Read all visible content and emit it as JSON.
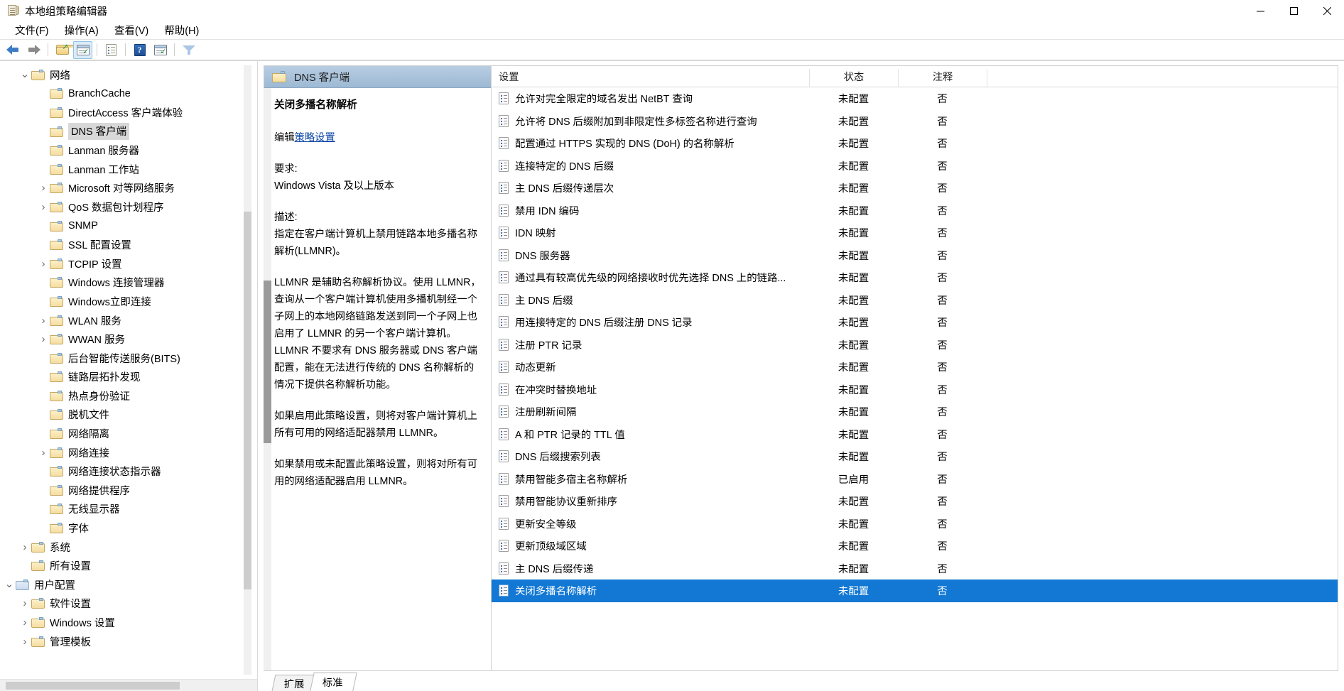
{
  "window": {
    "title": "本地组策略编辑器",
    "icon": "policy-document-icon",
    "minimize_label": "最小化",
    "maximize_label": "最大化",
    "close_label": "关闭"
  },
  "menubar": [
    {
      "label": "文件(F)",
      "name": "menu-file"
    },
    {
      "label": "操作(A)",
      "name": "menu-action"
    },
    {
      "label": "查看(V)",
      "name": "menu-view"
    },
    {
      "label": "帮助(H)",
      "name": "menu-help"
    }
  ],
  "toolbar": [
    {
      "name": "back-arrow-icon",
      "tooltip": "后退"
    },
    {
      "name": "forward-arrow-icon",
      "tooltip": "前进"
    },
    {
      "name": "up-folder-icon",
      "tooltip": "上移一级"
    },
    {
      "name": "show-hide-tree-icon",
      "tooltip": "显示/隐藏控制台树",
      "active": true
    },
    {
      "name": "properties-icon",
      "tooltip": "属性"
    },
    {
      "name": "help-icon",
      "tooltip": "帮助"
    },
    {
      "name": "refresh-view-icon",
      "tooltip": "刷新"
    },
    {
      "name": "filter-icon",
      "tooltip": "筛选器"
    }
  ],
  "tree": {
    "items": [
      {
        "label": "网络",
        "indent": 1,
        "chevron": "down",
        "selected": false
      },
      {
        "label": "BranchCache",
        "indent": 2,
        "chevron": "",
        "selected": false
      },
      {
        "label": "DirectAccess 客户端体验",
        "indent": 2,
        "chevron": "",
        "selected": false
      },
      {
        "label": "DNS 客户端",
        "indent": 2,
        "chevron": "",
        "selected": true
      },
      {
        "label": "Lanman 服务器",
        "indent": 2,
        "chevron": "",
        "selected": false
      },
      {
        "label": "Lanman 工作站",
        "indent": 2,
        "chevron": "",
        "selected": false
      },
      {
        "label": "Microsoft 对等网络服务",
        "indent": 2,
        "chevron": "right",
        "selected": false
      },
      {
        "label": "QoS 数据包计划程序",
        "indent": 2,
        "chevron": "right",
        "selected": false
      },
      {
        "label": "SNMP",
        "indent": 2,
        "chevron": "",
        "selected": false
      },
      {
        "label": "SSL 配置设置",
        "indent": 2,
        "chevron": "",
        "selected": false
      },
      {
        "label": "TCPIP 设置",
        "indent": 2,
        "chevron": "right",
        "selected": false
      },
      {
        "label": "Windows 连接管理器",
        "indent": 2,
        "chevron": "",
        "selected": false
      },
      {
        "label": "Windows立即连接",
        "indent": 2,
        "chevron": "",
        "selected": false
      },
      {
        "label": "WLAN 服务",
        "indent": 2,
        "chevron": "right",
        "selected": false
      },
      {
        "label": "WWAN 服务",
        "indent": 2,
        "chevron": "right",
        "selected": false
      },
      {
        "label": "后台智能传送服务(BITS)",
        "indent": 2,
        "chevron": "",
        "selected": false
      },
      {
        "label": "链路层拓扑发现",
        "indent": 2,
        "chevron": "",
        "selected": false
      },
      {
        "label": "热点身份验证",
        "indent": 2,
        "chevron": "",
        "selected": false
      },
      {
        "label": "脱机文件",
        "indent": 2,
        "chevron": "",
        "selected": false
      },
      {
        "label": "网络隔离",
        "indent": 2,
        "chevron": "",
        "selected": false
      },
      {
        "label": "网络连接",
        "indent": 2,
        "chevron": "right",
        "selected": false
      },
      {
        "label": "网络连接状态指示器",
        "indent": 2,
        "chevron": "",
        "selected": false
      },
      {
        "label": "网络提供程序",
        "indent": 2,
        "chevron": "",
        "selected": false
      },
      {
        "label": "无线显示器",
        "indent": 2,
        "chevron": "",
        "selected": false
      },
      {
        "label": "字体",
        "indent": 2,
        "chevron": "",
        "selected": false
      },
      {
        "label": "系统",
        "indent": 1,
        "chevron": "right",
        "selected": false
      },
      {
        "label": "所有设置",
        "indent": 1,
        "chevron": "",
        "selected": false
      },
      {
        "label": "用户配置",
        "indent": 0,
        "chevron": "down",
        "selected": false,
        "root": true
      },
      {
        "label": "软件设置",
        "indent": 1,
        "chevron": "right",
        "selected": false
      },
      {
        "label": "Windows 设置",
        "indent": 1,
        "chevron": "right",
        "selected": false
      },
      {
        "label": "管理模板",
        "indent": 1,
        "chevron": "right",
        "selected": false
      }
    ]
  },
  "details": {
    "header_title": "DNS 客户端",
    "policy_title": "关闭多播名称解析",
    "edit_prefix": "编辑",
    "edit_link": "策略设置",
    "requirement_label": "要求:",
    "requirement_value": "Windows Vista 及以上版本",
    "description_label": "描述:",
    "description_paragraphs": [
      "指定在客户端计算机上禁用链路本地多播名称解析(LLMNR)。",
      "LLMNR 是辅助名称解析协议。使用 LLMNR，查询从一个客户端计算机使用多播机制经一个子网上的本地网络链路发送到同一个子网上也启用了 LLMNR 的另一个客户端计算机。LLMNR 不要求有 DNS 服务器或 DNS 客户端配置，能在无法进行传统的 DNS 名称解析的情况下提供名称解析功能。",
      "如果启用此策略设置，则将对客户端计算机上所有可用的网络适配器禁用 LLMNR。",
      "如果禁用或未配置此策略设置，则将对所有可用的网络适配器启用 LLMNR。"
    ]
  },
  "list": {
    "columns": [
      "设置",
      "状态",
      "注释"
    ],
    "rows": [
      {
        "name": "允许对完全限定的域名发出 NetBT 查询",
        "state": "未配置",
        "comment": "否",
        "selected": false
      },
      {
        "name": "允许将 DNS 后缀附加到非限定性多标签名称进行查询",
        "state": "未配置",
        "comment": "否",
        "selected": false
      },
      {
        "name": "配置通过 HTTPS 实现的 DNS (DoH) 的名称解析",
        "state": "未配置",
        "comment": "否",
        "selected": false
      },
      {
        "name": "连接特定的 DNS 后缀",
        "state": "未配置",
        "comment": "否",
        "selected": false
      },
      {
        "name": "主 DNS 后缀传递层次",
        "state": "未配置",
        "comment": "否",
        "selected": false
      },
      {
        "name": "禁用 IDN 编码",
        "state": "未配置",
        "comment": "否",
        "selected": false
      },
      {
        "name": "IDN 映射",
        "state": "未配置",
        "comment": "否",
        "selected": false
      },
      {
        "name": "DNS 服务器",
        "state": "未配置",
        "comment": "否",
        "selected": false
      },
      {
        "name": "通过具有较高优先级的网络接收时优先选择 DNS 上的链路...",
        "state": "未配置",
        "comment": "否",
        "selected": false
      },
      {
        "name": "主 DNS 后缀",
        "state": "未配置",
        "comment": "否",
        "selected": false
      },
      {
        "name": "用连接特定的 DNS 后缀注册 DNS 记录",
        "state": "未配置",
        "comment": "否",
        "selected": false
      },
      {
        "name": "注册 PTR 记录",
        "state": "未配置",
        "comment": "否",
        "selected": false
      },
      {
        "name": "动态更新",
        "state": "未配置",
        "comment": "否",
        "selected": false
      },
      {
        "name": "在冲突时替换地址",
        "state": "未配置",
        "comment": "否",
        "selected": false
      },
      {
        "name": "注册刷新间隔",
        "state": "未配置",
        "comment": "否",
        "selected": false
      },
      {
        "name": "A 和 PTR 记录的 TTL 值",
        "state": "未配置",
        "comment": "否",
        "selected": false
      },
      {
        "name": "DNS 后缀搜索列表",
        "state": "未配置",
        "comment": "否",
        "selected": false
      },
      {
        "name": "禁用智能多宿主名称解析",
        "state": "已启用",
        "comment": "否",
        "selected": false
      },
      {
        "name": "禁用智能协议重新排序",
        "state": "未配置",
        "comment": "否",
        "selected": false
      },
      {
        "name": "更新安全等级",
        "state": "未配置",
        "comment": "否",
        "selected": false
      },
      {
        "name": "更新顶级域区域",
        "state": "未配置",
        "comment": "否",
        "selected": false
      },
      {
        "name": "主 DNS 后缀传递",
        "state": "未配置",
        "comment": "否",
        "selected": false
      },
      {
        "name": "关闭多播名称解析",
        "state": "未配置",
        "comment": "否",
        "selected": true
      }
    ]
  },
  "tabs": [
    {
      "label": "扩展",
      "active": false
    },
    {
      "label": "标准",
      "active": true
    }
  ],
  "colors": {
    "selection_blue": "#1278d4",
    "details_header": "#9db9d4",
    "link_blue": "#0b44a8",
    "tree_selected_bg": "#d8d8d8"
  }
}
